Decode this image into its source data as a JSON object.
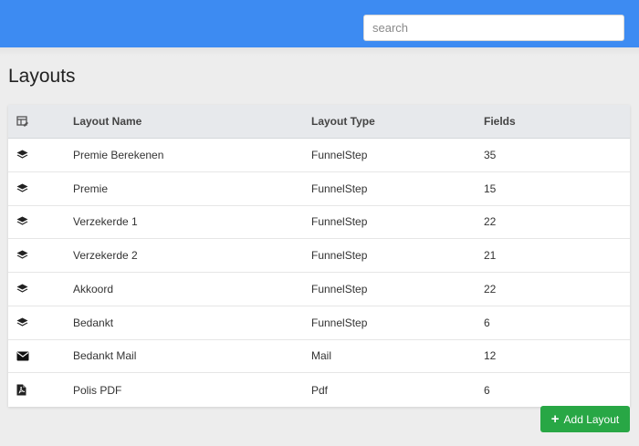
{
  "header": {
    "search": {
      "placeholder": "search",
      "value": ""
    }
  },
  "page": {
    "title": "Layouts"
  },
  "table": {
    "header_icon": "table-edit-icon",
    "columns": [
      "Layout Name",
      "Layout Type",
      "Fields"
    ],
    "rows": [
      {
        "icon": "layers-icon",
        "name": "Premie Berekenen",
        "type": "FunnelStep",
        "fields": "35"
      },
      {
        "icon": "layers-icon",
        "name": "Premie",
        "type": "FunnelStep",
        "fields": "15"
      },
      {
        "icon": "layers-icon",
        "name": "Verzekerde 1",
        "type": "FunnelStep",
        "fields": "22"
      },
      {
        "icon": "layers-icon",
        "name": "Verzekerde 2",
        "type": "FunnelStep",
        "fields": "21"
      },
      {
        "icon": "layers-icon",
        "name": "Akkoord",
        "type": "FunnelStep",
        "fields": "22"
      },
      {
        "icon": "layers-icon",
        "name": "Bedankt",
        "type": "FunnelStep",
        "fields": "6"
      },
      {
        "icon": "envelope-icon",
        "name": "Bedankt Mail",
        "type": "Mail",
        "fields": "12"
      },
      {
        "icon": "pdf-file-icon",
        "name": "Polis PDF",
        "type": "Pdf",
        "fields": "6"
      }
    ]
  },
  "actions": {
    "add_layout_label": "Add Layout"
  },
  "colors": {
    "topbar": "#3d8bf2",
    "add_button": "#28a745",
    "table_header": "#e7e9ec"
  }
}
